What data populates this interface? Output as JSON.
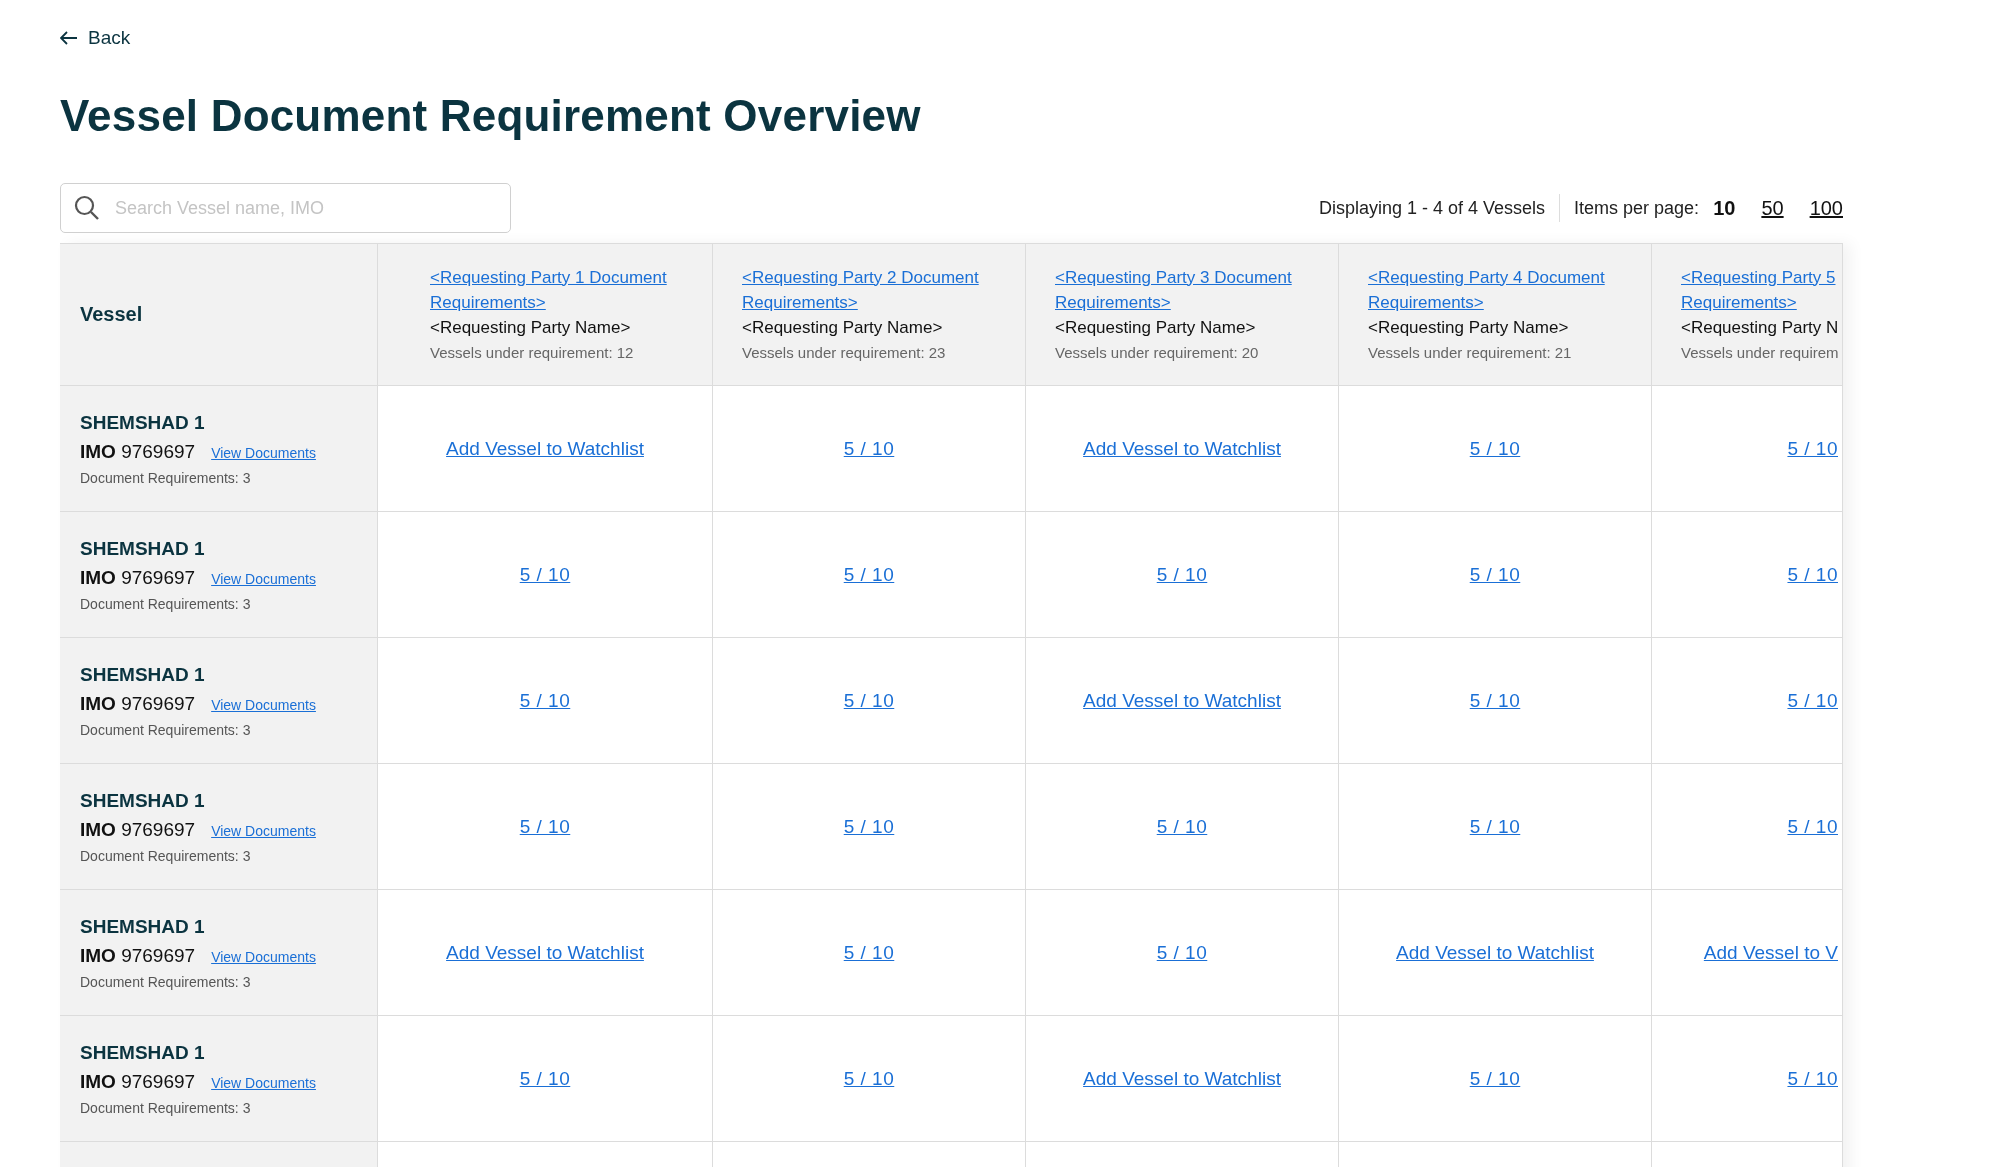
{
  "back": {
    "label": "Back"
  },
  "title": "Vessel Document Requirement Overview",
  "search": {
    "placeholder": "Search Vessel name, IMO"
  },
  "summary": "Displaying 1 - 4 of 4 Vessels",
  "items_per_page": {
    "label": "Items per page:",
    "options": [
      {
        "label": "10",
        "selected": true
      },
      {
        "label": "50",
        "selected": false
      },
      {
        "label": "100",
        "selected": false
      }
    ]
  },
  "table": {
    "vessel_heading": "Vessel",
    "columns": [
      {
        "title_lines": [
          "<Requesting Party 1 Document",
          "Requirements>"
        ],
        "party": "<Requesting Party Name>",
        "count": "Vessels under requirement: 12"
      },
      {
        "title_lines": [
          "<Requesting Party 2 Document",
          "Requirements>"
        ],
        "party": "<Requesting Party Name>",
        "count": "Vessels under requirement: 23"
      },
      {
        "title_lines": [
          "<Requesting Party 3 Document",
          "Requirements>"
        ],
        "party": "<Requesting Party Name>",
        "count": "Vessels under requirement: 20"
      },
      {
        "title_lines": [
          "<Requesting Party 4 Document",
          "Requirements>"
        ],
        "party": "<Requesting Party Name>",
        "count": "Vessels under requirement: 21"
      },
      {
        "title_lines": [
          "<Requesting Party 5",
          "Requirements>"
        ],
        "party": "<Requesting Party N",
        "count": "Vessels under requirem"
      }
    ],
    "rows": [
      {
        "name": "SHEMSHAD 1",
        "imo_label": "IMO",
        "imo": "9769697",
        "link": "View Documents",
        "requirements": "Document Requirements: 3",
        "cells": [
          {
            "kind": "watchlist",
            "text": "Add Vessel to Watchlist"
          },
          {
            "kind": "count",
            "text": "5 / 10"
          },
          {
            "kind": "watchlist",
            "text": "Add Vessel to Watchlist"
          },
          {
            "kind": "count",
            "text": "5 / 10"
          },
          {
            "kind": "count",
            "text": "5 / 10"
          }
        ]
      },
      {
        "name": "SHEMSHAD 1",
        "imo_label": "IMO",
        "imo": "9769697",
        "link": "View Documents",
        "requirements": "Document Requirements: 3",
        "cells": [
          {
            "kind": "count",
            "text": "5 / 10"
          },
          {
            "kind": "count",
            "text": "5 / 10"
          },
          {
            "kind": "count",
            "text": "5 / 10"
          },
          {
            "kind": "count",
            "text": "5 / 10"
          },
          {
            "kind": "count",
            "text": "5 / 10"
          }
        ]
      },
      {
        "name": "SHEMSHAD 1",
        "imo_label": "IMO",
        "imo": "9769697",
        "link": "View Documents",
        "requirements": "Document Requirements: 3",
        "cells": [
          {
            "kind": "count",
            "text": "5 / 10"
          },
          {
            "kind": "count",
            "text": "5 / 10"
          },
          {
            "kind": "watchlist",
            "text": "Add Vessel to Watchlist"
          },
          {
            "kind": "count",
            "text": "5 / 10"
          },
          {
            "kind": "count",
            "text": "5 / 10"
          }
        ]
      },
      {
        "name": "SHEMSHAD 1",
        "imo_label": "IMO",
        "imo": "9769697",
        "link": "View Documents",
        "requirements": "Document Requirements: 3",
        "cells": [
          {
            "kind": "count",
            "text": "5 / 10"
          },
          {
            "kind": "count",
            "text": "5 / 10"
          },
          {
            "kind": "count",
            "text": "5 / 10"
          },
          {
            "kind": "count",
            "text": "5 / 10"
          },
          {
            "kind": "count",
            "text": "5 / 10"
          }
        ]
      },
      {
        "name": "SHEMSHAD 1",
        "imo_label": "IMO",
        "imo": "9769697",
        "link": "View Documents",
        "requirements": "Document Requirements: 3",
        "cells": [
          {
            "kind": "watchlist",
            "text": "Add Vessel to Watchlist"
          },
          {
            "kind": "count",
            "text": "5 / 10"
          },
          {
            "kind": "count",
            "text": "5 / 10"
          },
          {
            "kind": "watchlist",
            "text": "Add Vessel to Watchlist"
          },
          {
            "kind": "watchlist",
            "text": "Add Vessel to V"
          }
        ]
      },
      {
        "name": "SHEMSHAD 1",
        "imo_label": "IMO",
        "imo": "9769697",
        "link": "View Documents",
        "requirements": "Document Requirements: 3",
        "cells": [
          {
            "kind": "count",
            "text": "5 / 10"
          },
          {
            "kind": "count",
            "text": "5 / 10"
          },
          {
            "kind": "watchlist",
            "text": "Add Vessel to Watchlist"
          },
          {
            "kind": "count",
            "text": "5 / 10"
          },
          {
            "kind": "count",
            "text": "5 / 10"
          }
        ]
      }
    ]
  }
}
